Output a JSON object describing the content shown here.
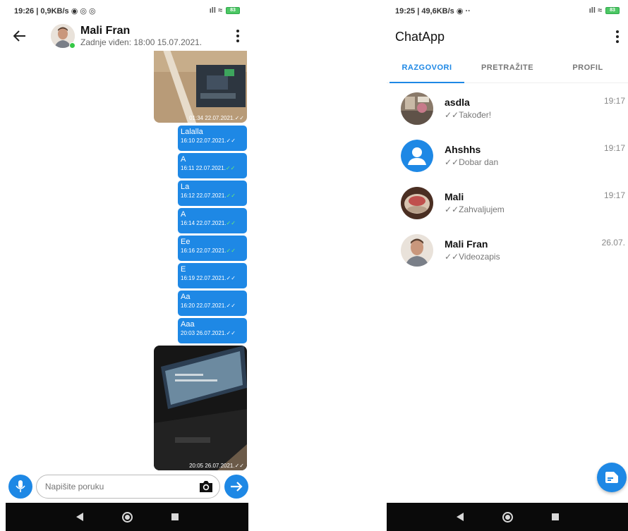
{
  "colors": {
    "accent": "#1e88e5",
    "online": "#35c846",
    "nav_bar": "#0a0a0a"
  },
  "left_screen": {
    "status_bar": {
      "text": "19:26 | 0,9KB/s ◉ ◎ ◎",
      "icons": "ıll ≈",
      "battery": "83"
    },
    "header": {
      "back_icon": "arrow-left-icon",
      "name": "Mali Fran",
      "last_seen": "Zadnje viđen: 18:00 15.07.2021.",
      "menu_icon": "more-vertical-icon"
    },
    "messages": [
      {
        "kind": "photo",
        "meta": "01:34 22.07.2021."
      },
      {
        "kind": "text",
        "text": "Lalalla",
        "meta": "16:10 22.07.2021."
      },
      {
        "kind": "text",
        "text": "A",
        "meta": "16:11 22.07.2021."
      },
      {
        "kind": "text",
        "text": "La",
        "meta": "16:12 22.07.2021."
      },
      {
        "kind": "text",
        "text": "A",
        "meta": "16:14 22.07.2021."
      },
      {
        "kind": "text",
        "text": "Ee",
        "meta": "16:16 22.07.2021."
      },
      {
        "kind": "text",
        "text": "E",
        "meta": "16:19 22.07.2021."
      },
      {
        "kind": "text",
        "text": "Aa",
        "meta": "16:20 22.07.2021."
      },
      {
        "kind": "text",
        "text": "Aaa",
        "meta": "20:03 26.07.2021."
      },
      {
        "kind": "photo",
        "meta": "20:05 26.07.2021."
      }
    ],
    "read_checks": "✓✓",
    "input": {
      "placeholder": "Napišite poruku",
      "mic_icon": "microphone-icon",
      "camera_icon": "camera-icon",
      "send_icon": "arrow-right-icon"
    }
  },
  "right_screen": {
    "status_bar": {
      "text": "19:25 | 49,6KB/s ◉ ··",
      "icons": "ıll ≈",
      "battery": "83"
    },
    "app_title": "ChatApp",
    "tabs": [
      {
        "label": "RAZGOVORI",
        "active": true
      },
      {
        "label": "PRETRAŽITE",
        "active": false
      },
      {
        "label": "PROFIL",
        "active": false
      }
    ],
    "conversations": [
      {
        "name": "asdla",
        "last_message": "✓✓Također!",
        "time": "19:17"
      },
      {
        "name": "Ahshhs",
        "last_message": "✓✓Dobar dan",
        "time": "19:17"
      },
      {
        "name": "Mali",
        "last_message": "✓✓Zahvaljujem",
        "time": "19:17"
      },
      {
        "name": "Mali Fran",
        "last_message": "✓✓Videozapis",
        "time": "26.07."
      }
    ],
    "fab_icon": "new-message-icon"
  }
}
